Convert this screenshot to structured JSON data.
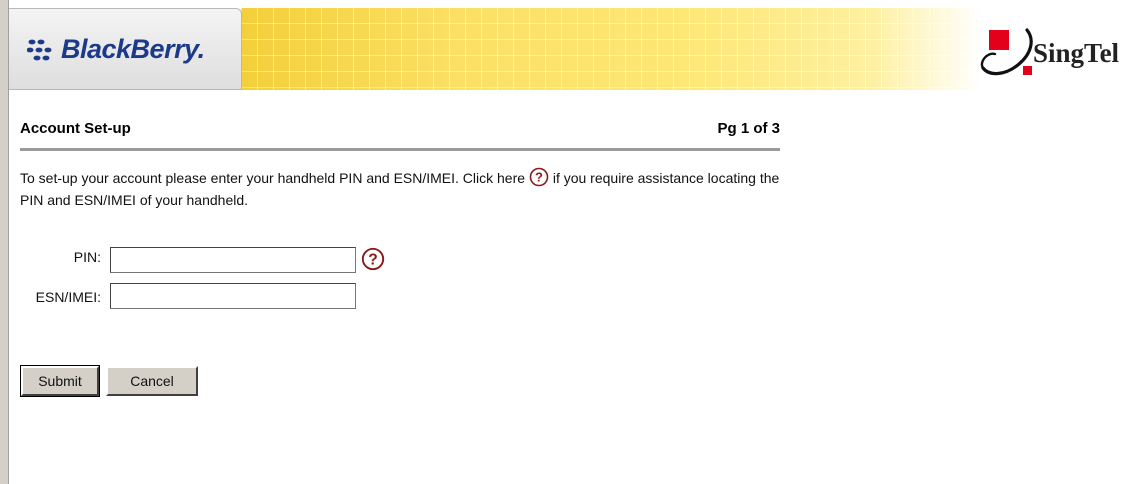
{
  "header": {
    "blackberry_logo": "BlackBerry.",
    "singtel_logo": "SingTel"
  },
  "page": {
    "title": "Account Set-up",
    "page_indicator": "Pg 1 of 3",
    "instructions_part1": "To set-up your account please enter your handheld PIN and ESN/IMEI. Click here",
    "instructions_part2": "if you require assistance locating the PIN and ESN/IMEI of your handheld."
  },
  "form": {
    "pin_label": "PIN:",
    "pin_value": "",
    "esn_label": "ESN/IMEI:",
    "esn_value": ""
  },
  "buttons": {
    "submit": "Submit",
    "cancel": "Cancel"
  },
  "colors": {
    "brand_blue": "#1b3a8a",
    "singtel_red": "#e2001a",
    "help_icon": "#8b1a1a"
  },
  "icons": {
    "help": "question-circle-icon",
    "blackberry": "blackberry-dots-icon",
    "singtel": "singtel-swoosh-icon"
  }
}
